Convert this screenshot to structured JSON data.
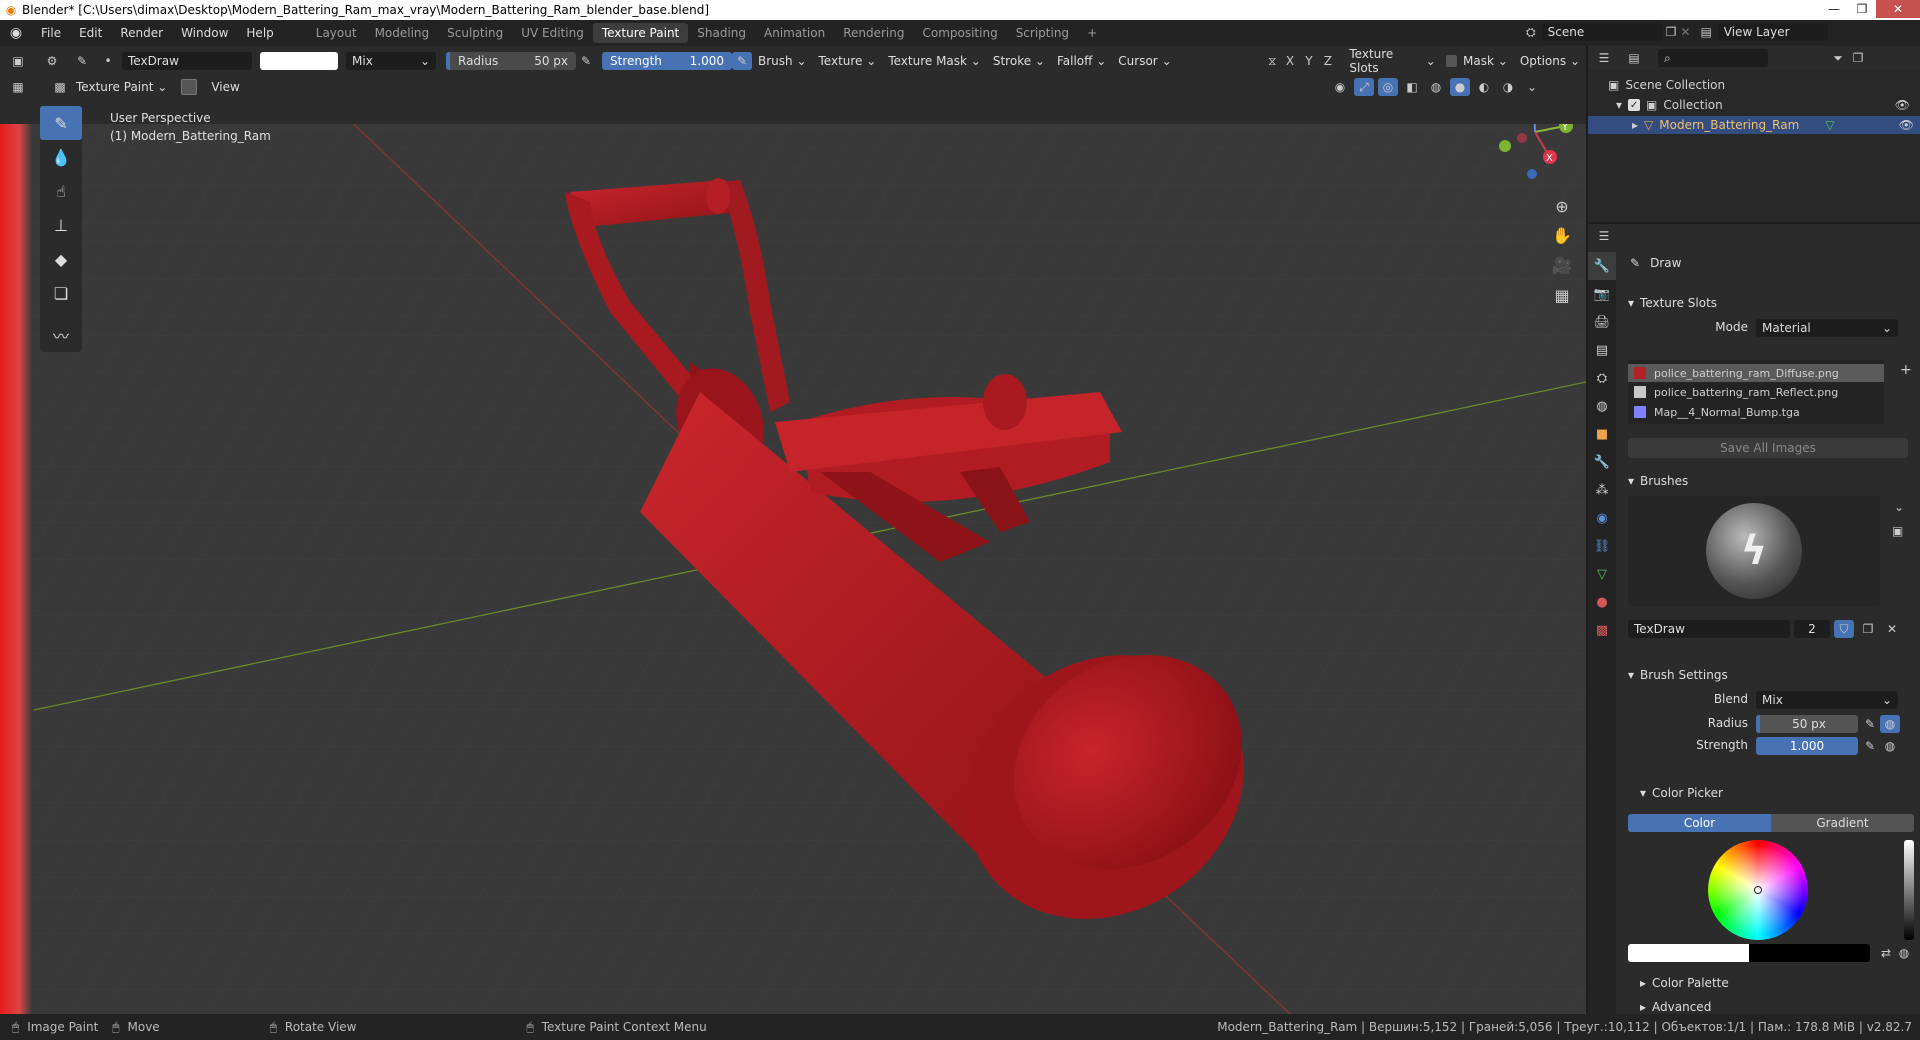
{
  "window": {
    "title": "Blender* [C:\\Users\\dimax\\Desktop\\Modern_Battering_Ram_max_vray\\Modern_Battering_Ram_blender_base.blend]",
    "controls": [
      "—",
      "❐",
      "✕"
    ]
  },
  "menu": [
    "File",
    "Edit",
    "Render",
    "Window",
    "Help"
  ],
  "workspaces": [
    "Layout",
    "Modeling",
    "Sculpting",
    "UV Editing",
    "Texture Paint",
    "Shading",
    "Animation",
    "Rendering",
    "Compositing",
    "Scripting",
    "+"
  ],
  "active_workspace": "Texture Paint",
  "scene": {
    "label": "Scene",
    "view_layer": "View Layer"
  },
  "tool_header": {
    "brush_name": "TexDraw",
    "blend": "Mix",
    "radius_label": "Radius",
    "radius_value": "50 px",
    "strength_label": "Strength",
    "strength_value": "1.000",
    "dropdowns": [
      "Brush",
      "Texture",
      "Texture Mask",
      "Stroke",
      "Falloff",
      "Cursor"
    ],
    "axes": [
      "X",
      "Y",
      "Z"
    ],
    "right_dropdowns": [
      "Texture Slots",
      "Mask",
      "Options"
    ],
    "color": "#ffffff"
  },
  "header_row2": {
    "mode": "Texture Paint",
    "view": "View"
  },
  "viewport": {
    "perspective": "User Perspective",
    "object": "(1) Modern_Battering_Ram",
    "gizmo": {
      "x": "X",
      "y": "Y",
      "z": "Z"
    }
  },
  "outliner": {
    "root": "Scene Collection",
    "collection": "Collection",
    "object": "Modern_Battering_Ram"
  },
  "properties": {
    "tool_name": "Draw",
    "texture_slots": {
      "title": "Texture Slots",
      "mode_label": "Mode",
      "mode_value": "Material",
      "items": [
        {
          "name": "police_battering_ram_Diffuse.png",
          "color": "#b22222"
        },
        {
          "name": "police_battering_ram_Reflect.png",
          "color": "#c8c8c8"
        },
        {
          "name": "Map__4_Normal_Bump.tga",
          "color": "#8080ff"
        }
      ],
      "save_all": "Save All Images"
    },
    "brushes": {
      "title": "Brushes",
      "name": "TexDraw",
      "users": "2"
    },
    "brush_settings": {
      "title": "Brush Settings",
      "blend_label": "Blend",
      "blend_value": "Mix",
      "radius_label": "Radius",
      "radius_value": "50 px",
      "strength_label": "Strength",
      "strength_value": "1.000"
    },
    "color_picker": {
      "title": "Color Picker",
      "tab_color": "Color",
      "tab_gradient": "Gradient"
    },
    "color_palette": "Color Palette",
    "advanced": "Advanced"
  },
  "statusbar": {
    "items": [
      "Image Paint",
      "Move",
      "Rotate View",
      "Texture Paint Context Menu"
    ],
    "right": "Modern_Battering_Ram | Вершин:5,152 | Граней:5,056 | Треуг.:10,112 | Объектов:1/1 | Пам.: 178.8 MiB | v2.82.7"
  },
  "colors": {
    "accent": "#4772b3",
    "mesh": "#b01c22",
    "bg": "#3a3a3a"
  }
}
